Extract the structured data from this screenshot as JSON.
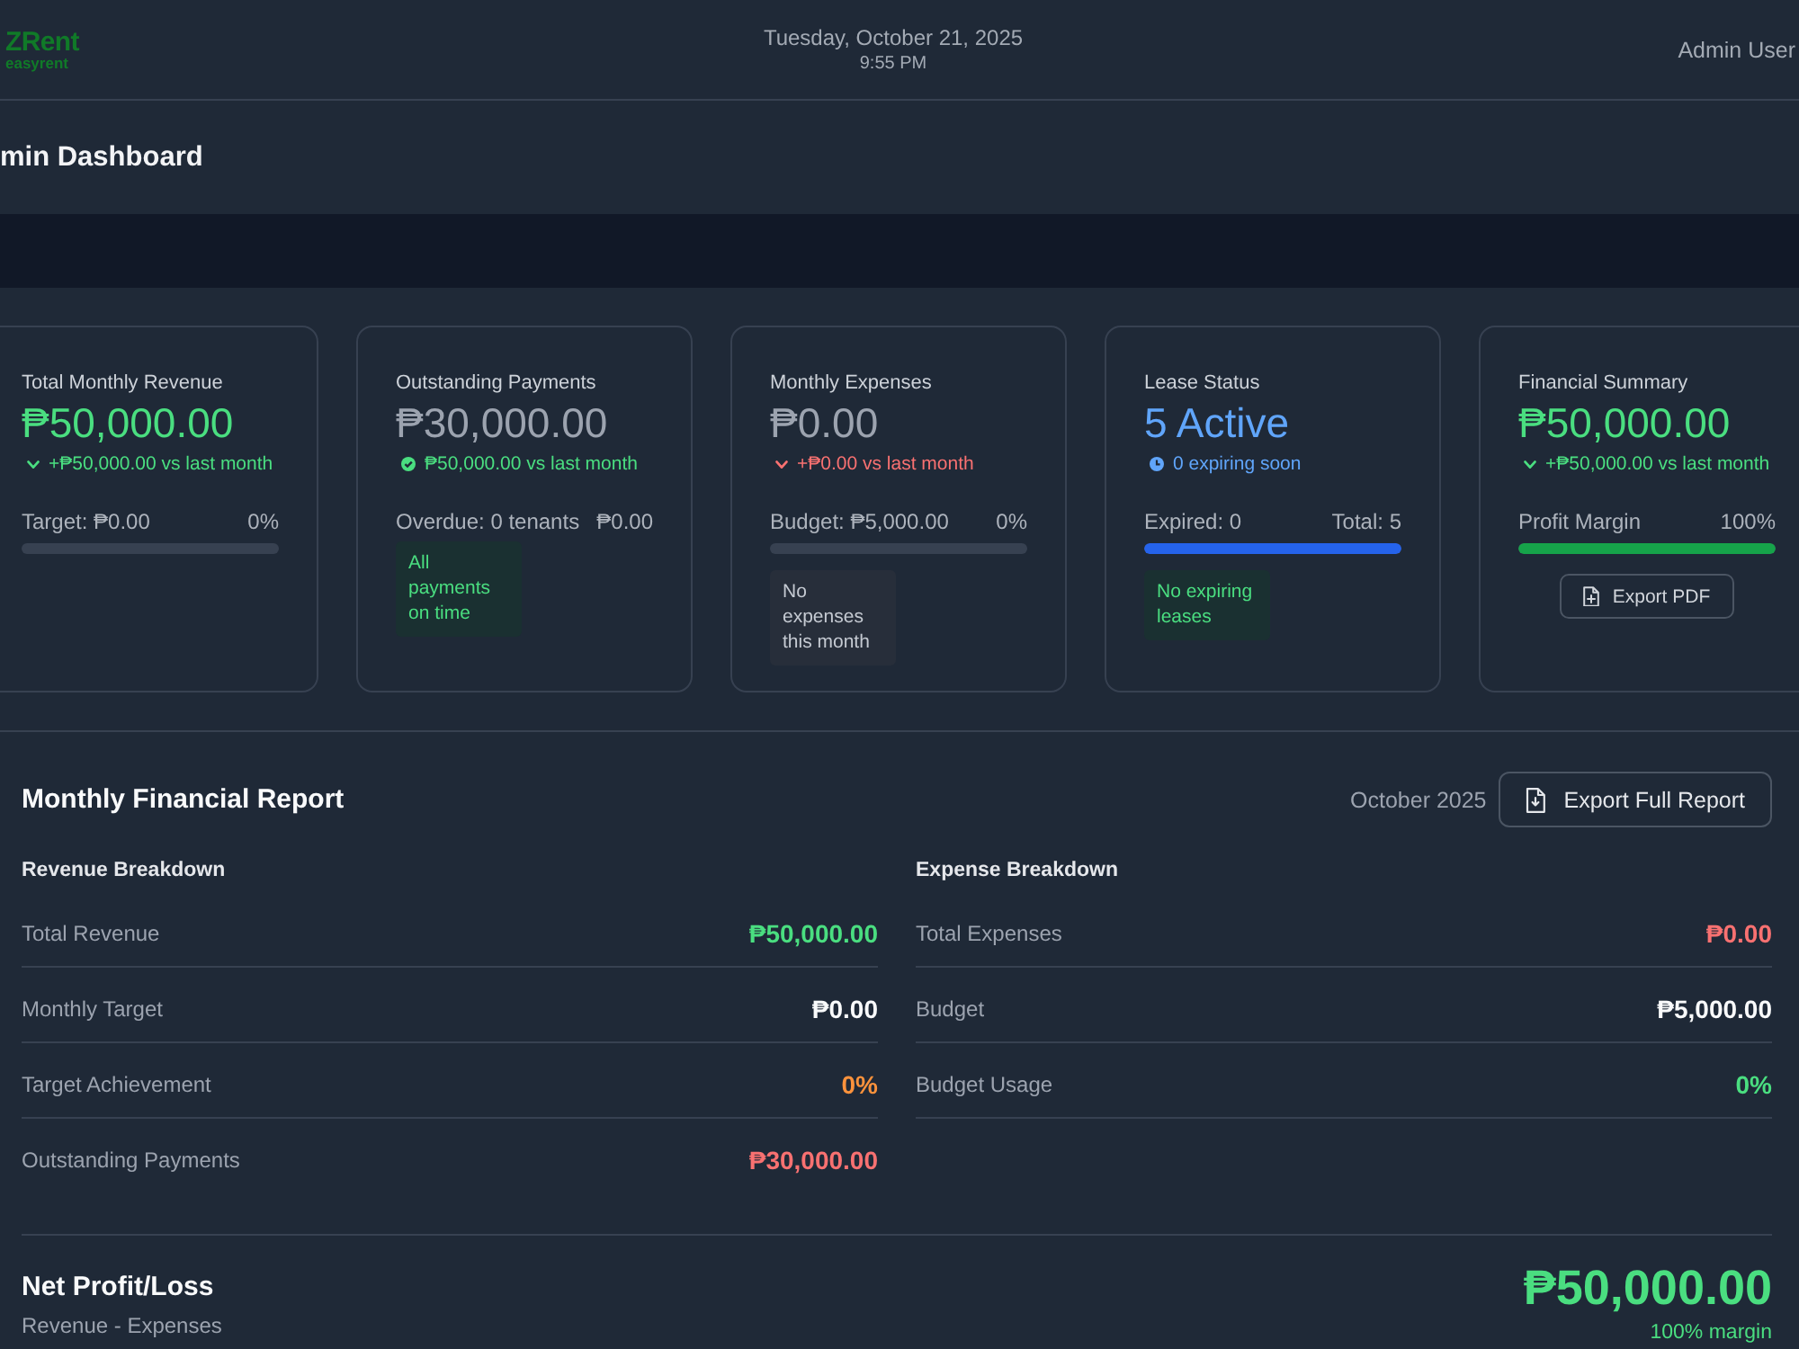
{
  "header": {
    "logo": "ZRent",
    "logo_tagline": "easyrent",
    "date": "Tuesday, October 21, 2025",
    "time": "9:55 PM",
    "user": "Admin User"
  },
  "page_title": "min Dashboard",
  "cards": [
    {
      "title": "Total Monthly Revenue",
      "value": "₱50,000.00",
      "color": "#4ade80",
      "trend": {
        "kind": "chevron",
        "text": "+₱50,000.00 vs last month",
        "color": "#4ade80"
      },
      "stats": {
        "label": "Target: ₱0.00",
        "reading": "0%"
      },
      "meter": {
        "level": 0
      }
    },
    {
      "title": "Outstanding Payments",
      "value": "₱30,000.00",
      "color": "#9ca3af",
      "trend": {
        "kind": "check",
        "text": "₱50,000.00 vs last month",
        "color": "#4ade80"
      },
      "stats": {
        "label": "Overdue: 0 tenants",
        "reading": "₱0.00"
      },
      "note": {
        "text": "All payments on time",
        "color": "#4ade80"
      }
    },
    {
      "title": "Monthly Expenses",
      "value": "₱0.00",
      "color": "#9ca3af",
      "trend": {
        "kind": "chevron",
        "text": "+₱0.00 vs last month",
        "color": "#f87171"
      },
      "stats": {
        "label": "Budget: ₱5,000.00",
        "reading": "0%"
      },
      "meter": {
        "level": 0
      },
      "note": {
        "text": "No expenses this month",
        "color": "#c5cad2"
      }
    },
    {
      "title": "Lease Status",
      "value": "5 Active",
      "color": "#60a5fa",
      "trend": {
        "kind": "clock",
        "text": "0 expiring soon",
        "color": "#60a5fa"
      },
      "stats": {
        "label": "Expired: 0",
        "reading": "Total: 5"
      },
      "meter": {
        "level": 1,
        "color": "#2563eb"
      },
      "note": {
        "text": "No expiring leases",
        "color": "#4ade80"
      }
    },
    {
      "title": "Financial Summary",
      "value": "₱50,000.00",
      "color": "#4ade80",
      "trend": {
        "kind": "chevron",
        "text": "+₱50,000.00 vs last month",
        "color": "#4ade80"
      },
      "stats": {
        "label": "Profit Margin",
        "reading": "100%"
      },
      "meter": {
        "level": 1,
        "color": "#16a34a"
      },
      "button": "Export PDF"
    }
  ],
  "report": {
    "title": "Monthly Financial Report",
    "period": "October 2025",
    "export_button": "Export Full Report",
    "columns": [
      {
        "heading": "Revenue Breakdown",
        "rows": [
          {
            "label": "Total Revenue",
            "value": "₱50,000.00",
            "color": "#4ade80"
          },
          {
            "label": "Monthly Target",
            "value": "₱0.00",
            "color": "#f9fafb"
          },
          {
            "label": "Target Achievement",
            "value": "0%",
            "color": "#fb923c"
          },
          {
            "label": "Outstanding Payments",
            "value": "₱30,000.00",
            "color": "#f87171"
          }
        ]
      },
      {
        "heading": "Expense Breakdown",
        "rows": [
          {
            "label": "Total Expenses",
            "value": "₱0.00",
            "color": "#f87171"
          },
          {
            "label": "Budget",
            "value": "₱5,000.00",
            "color": "#f9fafb"
          },
          {
            "label": "Budget Usage",
            "value": "0%",
            "color": "#4ade80"
          }
        ]
      }
    ],
    "net": {
      "title": "Net Profit/Loss",
      "subtitle": "Revenue - Expenses",
      "value": "₱50,000.00",
      "note": "100% margin",
      "color": "#4ade80"
    }
  }
}
